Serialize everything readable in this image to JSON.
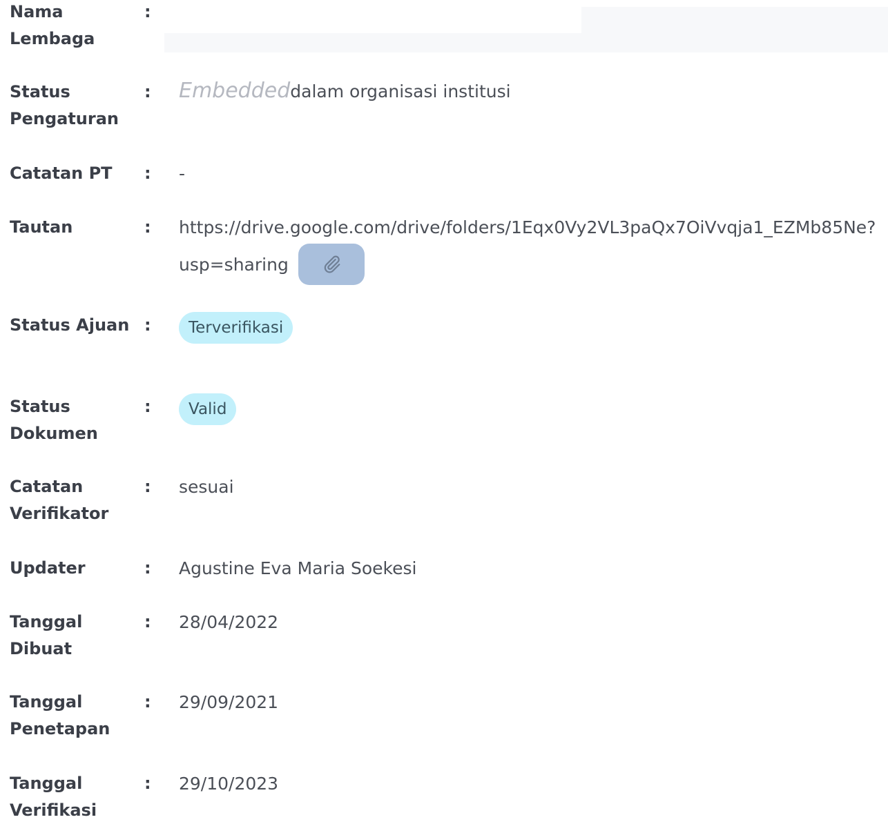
{
  "fields": [
    {
      "label": "Nama Lembaga",
      "value": ""
    },
    {
      "label": "Status Pengaturan",
      "value_italic": "Embedded",
      "value_rest": "dalam organisasi institusi"
    },
    {
      "label": "Catatan PT",
      "value": "-"
    },
    {
      "label": "Tautan",
      "link_line1": "https://drive.google.com/drive/folders/1Eqx0Vy2VL3paQx7OiVvqja1_EZMb85Ne?",
      "link_line2": "usp=sharing",
      "attach_icon": "paperclip-icon"
    },
    {
      "label": "Status Ajuan",
      "badge": "Terverifikasi"
    },
    {
      "label": "Status Dokumen",
      "badge": "Valid"
    },
    {
      "label": "Catatan Verifikator",
      "value": "sesuai"
    },
    {
      "label": "Updater",
      "value": "Agustine Eva Maria Soekesi"
    },
    {
      "label": "Tanggal Dibuat",
      "value": "28/04/2022"
    },
    {
      "label": "Tanggal Penetapan",
      "value": "29/09/2021"
    },
    {
      "label": "Tanggal Verifikasi",
      "value": "29/10/2023"
    }
  ],
  "colon": ":",
  "colors": {
    "badge_bg": "#c2f0fb",
    "attach_bg": "#a9bfdc"
  }
}
